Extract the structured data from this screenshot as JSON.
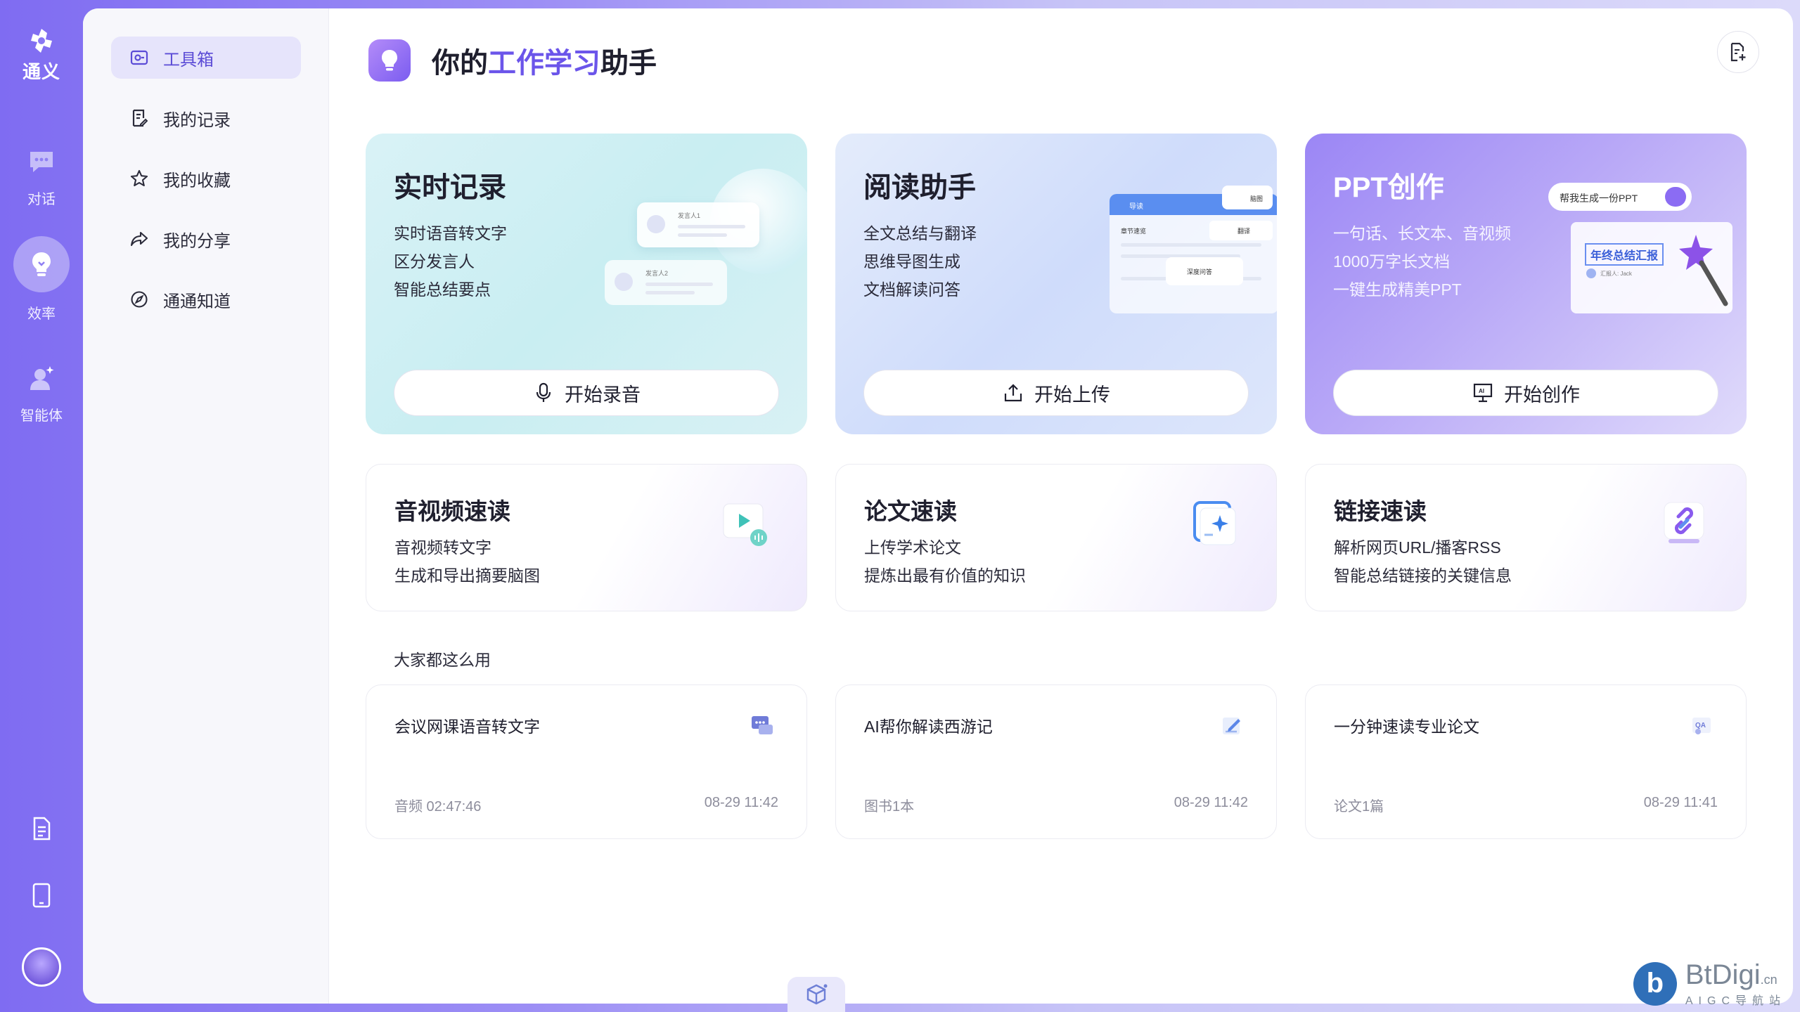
{
  "app": {
    "logo_text": "通义",
    "rail": [
      {
        "label": "对话",
        "icon": "chat-icon"
      },
      {
        "label": "效率",
        "icon": "lightbulb-icon"
      },
      {
        "label": "智能体",
        "icon": "agent-icon"
      }
    ],
    "rail_bottom_icons": [
      "document-icon",
      "tablet-icon",
      "avatar"
    ]
  },
  "sidebar": {
    "items": [
      {
        "label": "工具箱",
        "icon": "toolbox-icon",
        "active": true
      },
      {
        "label": "我的记录",
        "icon": "record-icon"
      },
      {
        "label": "我的收藏",
        "icon": "star-icon"
      },
      {
        "label": "我的分享",
        "icon": "share-icon"
      },
      {
        "label": "通通知道",
        "icon": "compass-icon"
      }
    ]
  },
  "header": {
    "title_prefix": "你的",
    "title_highlight": "工作学习",
    "title_suffix": "助手"
  },
  "feature_cards": [
    {
      "title": "实时记录",
      "lines": [
        "实时语音转文字",
        "区分发言人",
        "智能总结要点"
      ],
      "button": "开始录音",
      "illus": {
        "speaker1": "发言人1",
        "speaker2": "发言人2"
      }
    },
    {
      "title": "阅读助手",
      "lines": [
        "全文总结与翻译",
        "思维导图生成",
        "文档解读问答"
      ],
      "button": "开始上传",
      "illus": {
        "guide": "导读",
        "chapter": "章节速览",
        "translate": "翻译",
        "qa": "深度问答",
        "outline": "脑图"
      }
    },
    {
      "title": "PPT创作",
      "lines": [
        "一句话、长文本、音视频",
        "1000万字长文档",
        "一键生成精美PPT"
      ],
      "button": "开始创作",
      "illus": {
        "prompt": "帮我生成一份PPT",
        "slide_title": "年终总结汇报",
        "reporter": "汇报人: Jack"
      }
    }
  ],
  "quick_cards": [
    {
      "title": "音视频速读",
      "lines": [
        "音视频转文字",
        "生成和导出摘要脑图"
      ]
    },
    {
      "title": "论文速读",
      "lines": [
        "上传学术论文",
        "提炼出最有价值的知识"
      ]
    },
    {
      "title": "链接速读",
      "lines": [
        "解析网页URL/播客RSS",
        "智能总结链接的关键信息"
      ]
    }
  ],
  "section_label": "大家都这么用",
  "recent": [
    {
      "title": "会议网课语音转文字",
      "meta": "音频 02:47:46",
      "time": "08-29 11:42"
    },
    {
      "title": "AI帮你解读西游记",
      "meta": "图书1本",
      "time": "08-29 11:42"
    },
    {
      "title": "一分钟速读专业论文",
      "meta": "论文1篇",
      "time": "08-29 11:41"
    }
  ],
  "watermark": {
    "name": "BtDigi",
    "domain": ".cn",
    "sub": "AIGC导航站",
    "logo": "b"
  },
  "colors": {
    "accent": "#6b55ea",
    "rail_gradient_start": "#7f6cf2",
    "nav_active_bg": "#e6e4fb"
  }
}
